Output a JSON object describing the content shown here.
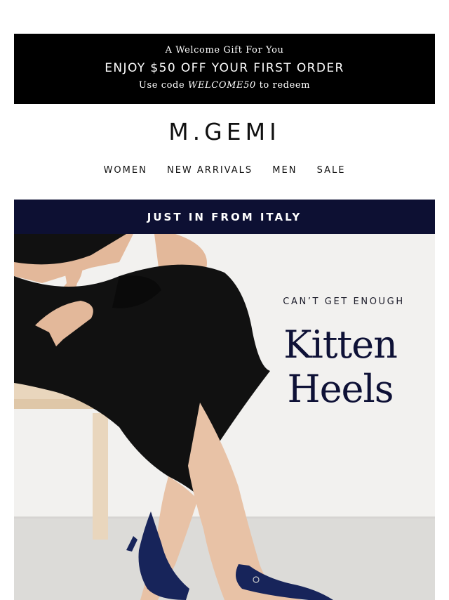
{
  "promo": {
    "line1": "A Welcome Gift For You",
    "line2": "ENJOY $50 OFF YOUR FIRST ORDER",
    "line3_prefix": "Use code ",
    "line3_code": "WELCOME50",
    "line3_suffix": " to redeem"
  },
  "brand": {
    "logo": "M.GEMI"
  },
  "nav": {
    "items": [
      {
        "label": "WOMEN"
      },
      {
        "label": "NEW ARRIVALS"
      },
      {
        "label": "MEN"
      },
      {
        "label": "SALE"
      }
    ]
  },
  "hero": {
    "bar_text": "JUST IN FROM ITALY",
    "kicker": "CAN’T GET ENOUGH",
    "headline_line1": "Kitten",
    "headline_line2": "Heels"
  },
  "colors": {
    "promo_bg": "#000000",
    "hero_bar_bg": "#0d1033",
    "headline": "#0e1136",
    "hero_bg": "#f2f1ef"
  }
}
